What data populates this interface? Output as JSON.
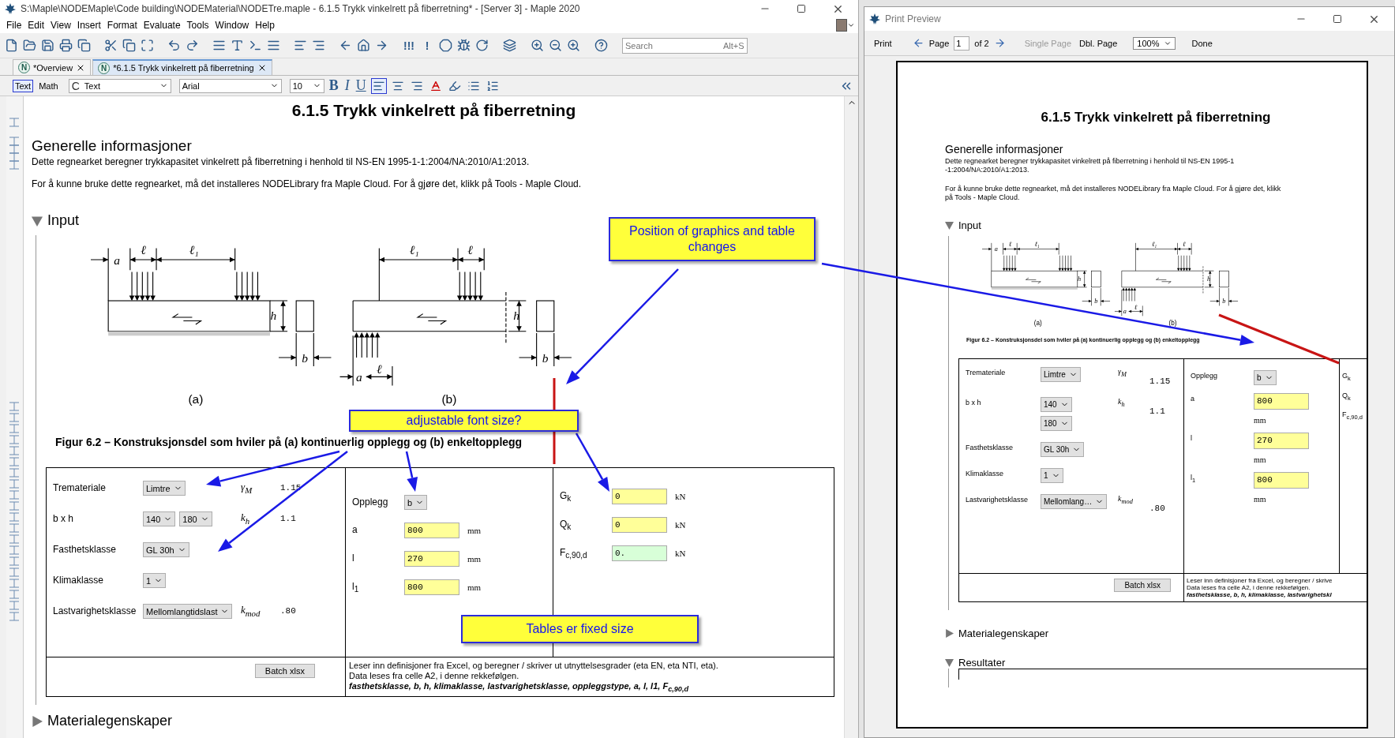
{
  "main_window": {
    "title": "S:\\Maple\\NODEMaple\\Code building\\NODEMaterial\\NODETre.maple - 6.1.5 Trykk vinkelrett på fiberretning* - [Server 3] - Maple 2020",
    "menu": [
      "File",
      "Edit",
      "View",
      "Insert",
      "Format",
      "Evaluate",
      "Tools",
      "Window",
      "Help"
    ],
    "toolbar": {
      "execute_buttons": [
        "!!!",
        "!"
      ],
      "search": {
        "placeholder": "Search",
        "shortcut": "Alt+S"
      }
    },
    "tabs": [
      {
        "badge": "N",
        "label": "*Overview",
        "selected": false
      },
      {
        "badge": "N",
        "label": "*6.1.5 Trykk vinkelrett på fiberretning",
        "selected": true
      }
    ],
    "format_bar": {
      "modes": [
        {
          "label": "Text",
          "selected": true
        },
        {
          "label": "Math",
          "selected": false
        }
      ],
      "style_prefix": "C",
      "style": "Text",
      "font": "Arial",
      "size": "10",
      "text_buttons": [
        {
          "kind": "bold",
          "label": "B"
        },
        {
          "kind": "italic",
          "label": "I"
        },
        {
          "kind": "underline",
          "label": "U"
        }
      ]
    },
    "document": {
      "title": "6.1.5 Trykk vinkelrett på fiberretning",
      "info_heading": "Generelle informasjoner",
      "paragraphs": [
        "Dette regnearket beregner trykkapasitet vinkelrett på fiberretning i henhold til NS-EN 1995-1-1:2004/NA:2010/A1:2013.",
        "For å kunne bruke dette regnearket, må det installeres NODELibrary fra Maple Cloud. For å gjøre det, klikk på Tools - Maple Cloud."
      ],
      "input_section": {
        "heading": "Input",
        "expanded": true,
        "figure": {
          "panels": [
            {
              "caption": "(a)",
              "labels": [
                "a",
                "ℓ",
                "ℓ₁",
                "h",
                "b"
              ]
            },
            {
              "caption": "(b)",
              "labels": [
                "ℓ₁",
                "ℓ",
                "h",
                "b",
                "a",
                "ℓ"
              ]
            }
          ],
          "caption": "Figur 6.2 – Konstruksjonsdel som hviler på (a) kontinuerlig opplegg og (b) enkeltopplegg"
        },
        "table": {
          "material_rows": [
            {
              "label": "Tremateriale",
              "dropdowns": [
                "Limtre"
              ],
              "symbol": "γ$_{M}$",
              "value": "1.15"
            },
            {
              "label": "b x h",
              "dropdowns": [
                "140",
                "180"
              ],
              "symbol": "k$_{h}$",
              "value": "1.1"
            },
            {
              "label": "Fasthetsklasse",
              "dropdowns": [
                "GL 30h"
              ]
            },
            {
              "label": "Klimaklasse",
              "dropdowns": [
                "1"
              ]
            },
            {
              "label": "Lastvarighetsklasse",
              "dropdowns": [
                "Mellomlangtidslast"
              ],
              "symbol": "k$_{mod}$",
              "value": ".80"
            }
          ],
          "support_rows": [
            {
              "label": "Opplegg",
              "kind": "dropdown",
              "value": "b"
            },
            {
              "label": "a",
              "kind": "input",
              "value": "800",
              "unit": "mm"
            },
            {
              "label": "l",
              "kind": "input",
              "value": "270",
              "unit": "mm"
            },
            {
              "label": "l$_{1}$",
              "kind": "input",
              "value": "800",
              "unit": "mm"
            }
          ],
          "load_rows": [
            {
              "label": "G$_{k}$",
              "kind": "input",
              "value": "0",
              "unit": "kN"
            },
            {
              "label": "Q$_{k}$",
              "kind": "input",
              "value": "0",
              "unit": "kN"
            },
            {
              "label": "F$_{c,90,d}$",
              "kind": "output",
              "value": "0.",
              "unit": "kN"
            }
          ],
          "batch_button": "Batch xlsx",
          "note_lines": [
            "Leser inn definisjoner fra Excel, og beregner / skriver ut utnyttelsesgrader (eta EN, eta NTI, eta).",
            "Data leses fra celle A2, i denne rekkefølgen.",
            "fasthetsklasse, b, h, klimaklasse, lastvarighetsklasse, oppleggstype, a, l, l1, F$_{c,90,d}$"
          ]
        }
      },
      "sections": [
        {
          "heading": "Materialegenskaper",
          "expanded": false
        }
      ]
    }
  },
  "print_preview": {
    "title": "Print Preview",
    "toolbar": {
      "print": "Print",
      "page_label": "Page",
      "page": "1",
      "page_count": "of 2",
      "views": [
        {
          "label": "Single Page",
          "disabled": true
        },
        {
          "label": "Dbl. Page",
          "disabled": false
        }
      ],
      "zoom": "100%",
      "done": "Done"
    },
    "document": {
      "title": "6.1.5 Trykk vinkelrett på fiberretning",
      "info_heading": "Generelle informasjoner",
      "paragraphs": [
        "Dette regnearket beregner trykkapasitet vinkelrett på fiberretning i henhold til NS-EN 1995-1 -1:2004/NA:2010/A1:2013.",
        "For å kunne bruke dette regnearket, må det installeres NODELibrary fra Maple Cloud. For å gjøre det, klikk på Tools - Maple Cloud."
      ],
      "input_section": {
        "heading": "Input",
        "expanded": true,
        "figure": {
          "panels": [
            {
              "caption": "(a)",
              "labels": [
                "a",
                "ℓ",
                "ℓ₁",
                "h",
                "b"
              ]
            },
            {
              "caption": "(b)",
              "labels": [
                "ℓ₁",
                "ℓ",
                "h",
                "b",
                "a",
                "ℓ"
              ]
            }
          ],
          "caption": "Figur 6.2 – Konstruksjonsdel som hviler på (a) kontinuerlig opplegg og (b) enkeltopplegg"
        },
        "table": {
          "material_rows": [
            {
              "label": "Tremateriale",
              "dropdowns": [
                "Limtre"
              ],
              "symbol": "γ$_{M}$",
              "value": "1.15"
            },
            {
              "label": "b x h",
              "dropdowns": [
                "140",
                "180"
              ],
              "symbol": "k$_{h}$",
              "value": "1.1"
            },
            {
              "label": "Fasthetsklasse",
              "dropdowns": [
                "GL 30h"
              ]
            },
            {
              "label": "Klimaklasse",
              "dropdowns": [
                "1"
              ]
            },
            {
              "label": "Lastvarighetsklasse",
              "dropdowns": [
                "Mellomlang…"
              ],
              "symbol": "k$_{mod}$",
              "value": ".80"
            }
          ],
          "support_rows": [
            {
              "label": "Opplegg",
              "kind": "dropdown",
              "value": "b"
            },
            {
              "label": "a",
              "kind": "input",
              "value": "800",
              "unit": "mm"
            },
            {
              "label": "l",
              "kind": "input",
              "value": "270",
              "unit": "mm"
            },
            {
              "label": "l$_{1}$",
              "kind": "input",
              "value": "800",
              "unit": "mm"
            }
          ],
          "load_rows": [
            {
              "label": "G$_{k}$"
            },
            {
              "label": "Q$_{k}$"
            },
            {
              "label": "F$_{c,90,d}$"
            }
          ],
          "batch_button": "Batch xlsx",
          "note_lines": [
            "Leser inn definisjoner fra Excel, og beregner / skrive",
            "Data leses fra celle A2, i denne rekkefølgen.",
            "fasthetsklasse, b, h, klimaklasse, lastvarighetskl"
          ]
        }
      },
      "sections": [
        {
          "heading": "Materialegenskaper",
          "expanded": false
        },
        {
          "heading": "Resultater",
          "expanded": true
        }
      ]
    }
  },
  "annotations": [
    {
      "text": "Position of graphics and table changes"
    },
    {
      "text": "adjustable font size?"
    },
    {
      "text": "Tables er fixed size"
    }
  ]
}
